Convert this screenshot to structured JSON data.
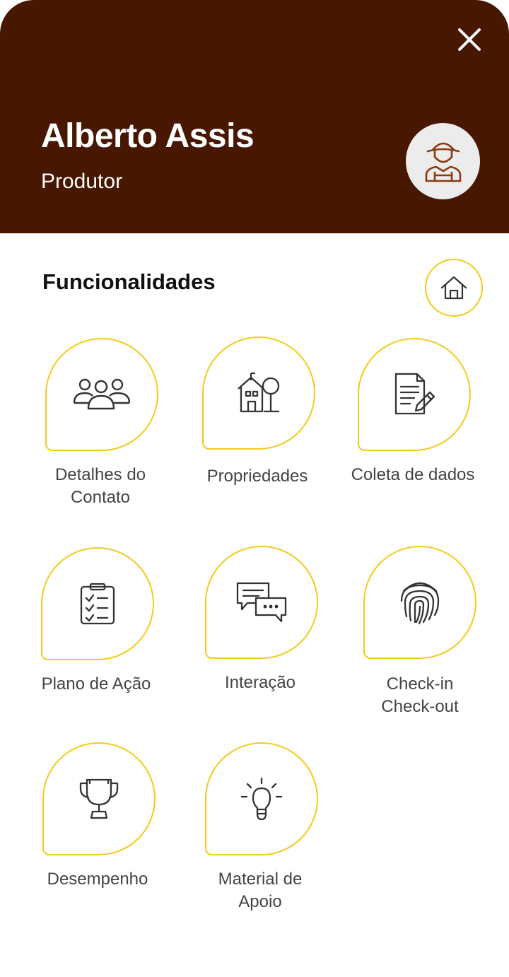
{
  "header": {
    "user_name": "Alberto Assis",
    "user_role": "Produtor",
    "background_color": "#471700",
    "close_icon": "close-icon",
    "avatar_icon": "farmer-icon"
  },
  "section": {
    "title": "Funcionalidades",
    "home_icon": "home-icon"
  },
  "accent_color": "#f2cb1d",
  "features": [
    {
      "label": "Detalhes do\nContato",
      "icon": "contacts-icon"
    },
    {
      "label": "Propriedades",
      "icon": "property-icon"
    },
    {
      "label": "Coleta de dados",
      "icon": "data-collection-icon"
    },
    {
      "label": "Plano de Ação",
      "icon": "action-plan-icon"
    },
    {
      "label": "Interação",
      "icon": "interaction-icon"
    },
    {
      "label": "Check-in\nCheck-out",
      "icon": "fingerprint-icon"
    },
    {
      "label": "Desempenho",
      "icon": "trophy-icon"
    },
    {
      "label": "Material de\nApoio",
      "icon": "lightbulb-icon"
    }
  ]
}
